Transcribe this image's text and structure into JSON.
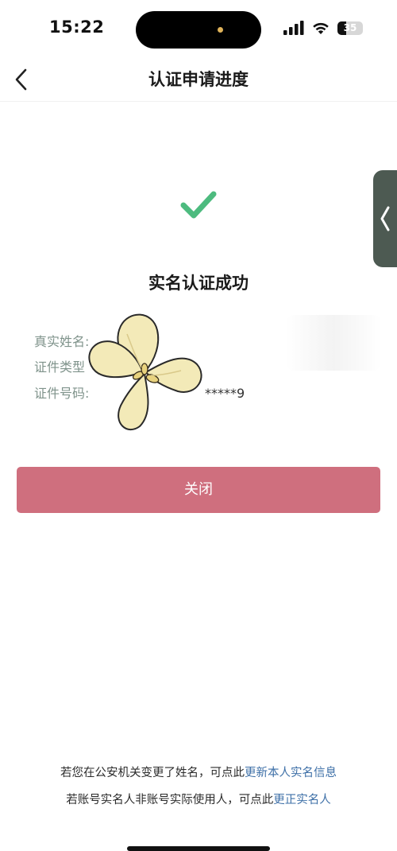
{
  "status_bar": {
    "time": "15:22",
    "battery": "35",
    "battery_level": 0.35,
    "icons": [
      "cellular-signal-icon",
      "wifi-icon",
      "battery-icon"
    ]
  },
  "nav": {
    "title": "认证申请进度",
    "back_icon": "chevron-left-icon"
  },
  "side_tab": {
    "icon": "chevron-left-icon"
  },
  "result": {
    "icon": "checkmark-icon",
    "title": "实名认证成功"
  },
  "info": {
    "real_name_label": "真实姓名:",
    "id_type_label": "证件类型",
    "id_number_label": "证件号码:",
    "id_number_value": "*****9"
  },
  "actions": {
    "close_label": "关闭"
  },
  "footer": {
    "line1_text": "若您在公安机关变更了姓名，可点此",
    "line1_link": "更新本人实名信息",
    "line2_text": "若账号实名人非账号实际使用人，可点此",
    "line2_link": "更正实名人"
  },
  "colors": {
    "accent_button": "#cf6f7e",
    "success_check": "#4dbb7f",
    "link": "#3d6fa7",
    "label": "#7f938b",
    "side_tab": "#4d5a52"
  }
}
